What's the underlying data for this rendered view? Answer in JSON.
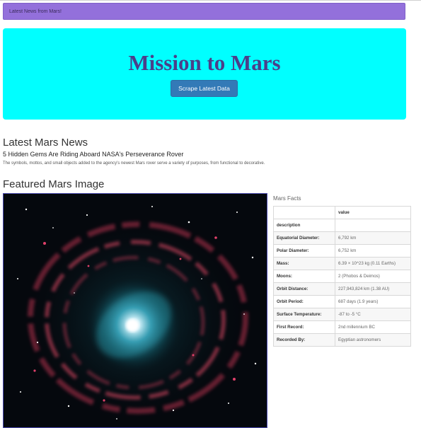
{
  "navbar": {
    "brand": "Latest News from Mars!"
  },
  "jumbotron": {
    "title": "Mission to Mars",
    "button_label": "Scrape Latest Data"
  },
  "news": {
    "heading": "Latest Mars News",
    "title": "5 Hidden Gems Are Riding Aboard NASA's Perseverance Rover",
    "paragraph": "The symbols, mottos, and small objects added to the agency's newest Mars rover serve a variety of purposes, from functional to decorative."
  },
  "featured": {
    "heading": "Featured Mars Image"
  },
  "facts": {
    "label": "Mars Facts",
    "header": [
      "",
      "value"
    ],
    "rows": [
      {
        "key": "description",
        "value": ""
      },
      {
        "key": "Equatorial Diameter:",
        "value": "6,792 km"
      },
      {
        "key": "Polar Diameter:",
        "value": "6,752 km"
      },
      {
        "key": "Mass:",
        "value": "6.39 × 10^23 kg (0.11 Earths)"
      },
      {
        "key": "Moons:",
        "value": "2 (Phobos & Deimos)"
      },
      {
        "key": "Orbit Distance:",
        "value": "227,943,824 km (1.38 AU)"
      },
      {
        "key": "Orbit Period:",
        "value": "687 days (1.9 years)"
      },
      {
        "key": "Surface Temperature:",
        "value": "-87 to -5 °C"
      },
      {
        "key": "First Record:",
        "value": "2nd millennium BC"
      },
      {
        "key": "Recorded By:",
        "value": "Egyptian astronomers"
      }
    ]
  },
  "colors": {
    "navbar_bg": "#9370db",
    "jumbotron_bg": "#00ffff",
    "title_color": "#4b3f8a",
    "button_bg": "#337ab7"
  }
}
